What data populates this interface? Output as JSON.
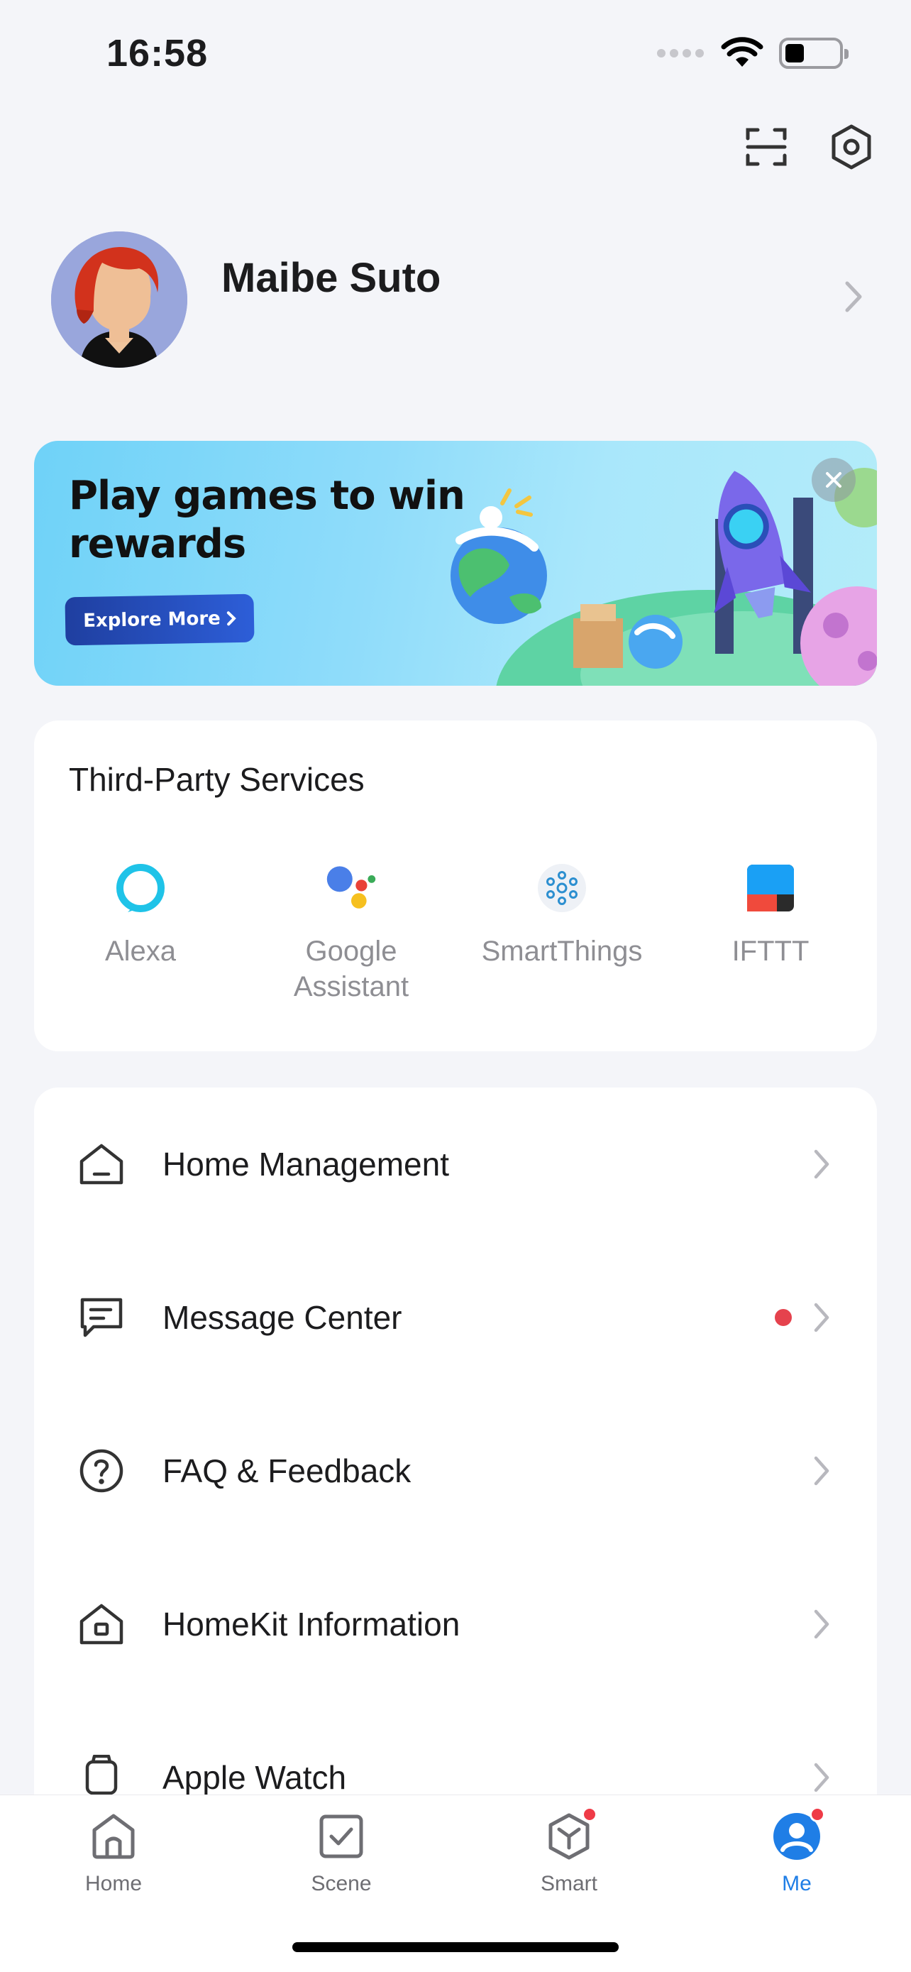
{
  "status_bar": {
    "time": "16:58"
  },
  "header": {
    "scan_icon": "scan-icon",
    "settings_icon": "settings-icon"
  },
  "profile": {
    "name": "Maibe Suto"
  },
  "banner": {
    "title": "Play games to win rewards",
    "button_label": "Explore More"
  },
  "third_party": {
    "title": "Third-Party Services",
    "services": [
      {
        "label": "Alexa",
        "icon": "alexa-icon"
      },
      {
        "label": "Google Assistant",
        "icon": "google-assistant-icon"
      },
      {
        "label": "SmartThings",
        "icon": "smartthings-icon"
      },
      {
        "label": "IFTTT",
        "icon": "ifttt-icon"
      }
    ]
  },
  "menu": {
    "items": [
      {
        "label": "Home Management",
        "icon": "home-management-icon"
      },
      {
        "label": "Message Center",
        "icon": "message-icon",
        "has_badge": true
      },
      {
        "label": "FAQ & Feedback",
        "icon": "question-icon"
      },
      {
        "label": "HomeKit Information",
        "icon": "homekit-icon"
      },
      {
        "label": "Apple Watch",
        "icon": "watch-icon"
      }
    ]
  },
  "tabs": [
    {
      "label": "Home",
      "active": false
    },
    {
      "label": "Scene",
      "active": false
    },
    {
      "label": "Smart",
      "active": false,
      "badge": true
    },
    {
      "label": "Me",
      "active": true,
      "badge": true
    }
  ],
  "colors": {
    "accent": "#1f7ee6",
    "badge": "#e5424d",
    "background": "#f4f5f9"
  }
}
